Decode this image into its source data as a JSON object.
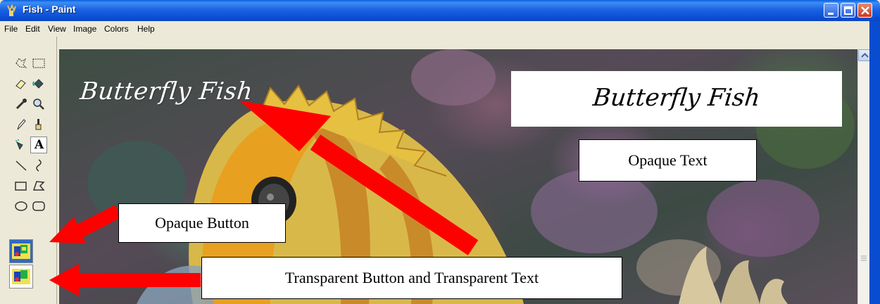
{
  "window": {
    "title": "Fish - Paint",
    "title_color": "#FFFFFF",
    "titlebar_color": "#0A5FE0"
  },
  "menu": {
    "items": [
      "File",
      "Edit",
      "View",
      "Image",
      "Colors",
      "Help"
    ]
  },
  "toolbox": {
    "tools": [
      "free-select-icon",
      "rect-select-icon",
      "eraser-icon",
      "fill-icon",
      "color-picker-icon",
      "magnifier-icon",
      "pencil-icon",
      "brush-icon",
      "airbrush-icon",
      "text-icon",
      "line-icon",
      "curve-icon",
      "rectangle-icon",
      "polygon-icon",
      "ellipse-icon",
      "rounded-rect-icon"
    ],
    "selected_tool": "text-icon",
    "text_tool_glyph": "A",
    "options": [
      "opaque-option",
      "transparent-option"
    ],
    "selected_option": "opaque-option"
  },
  "canvas": {
    "transparent_text": "Butterfly Fish",
    "opaque_text": "Butterfly Fish"
  },
  "annotations": {
    "opaque_text_label": "Opaque Text",
    "opaque_button_label": "Opaque Button",
    "transparent_label": "Transparent Button and Transparent Text",
    "arrow_color": "#FF0000"
  }
}
